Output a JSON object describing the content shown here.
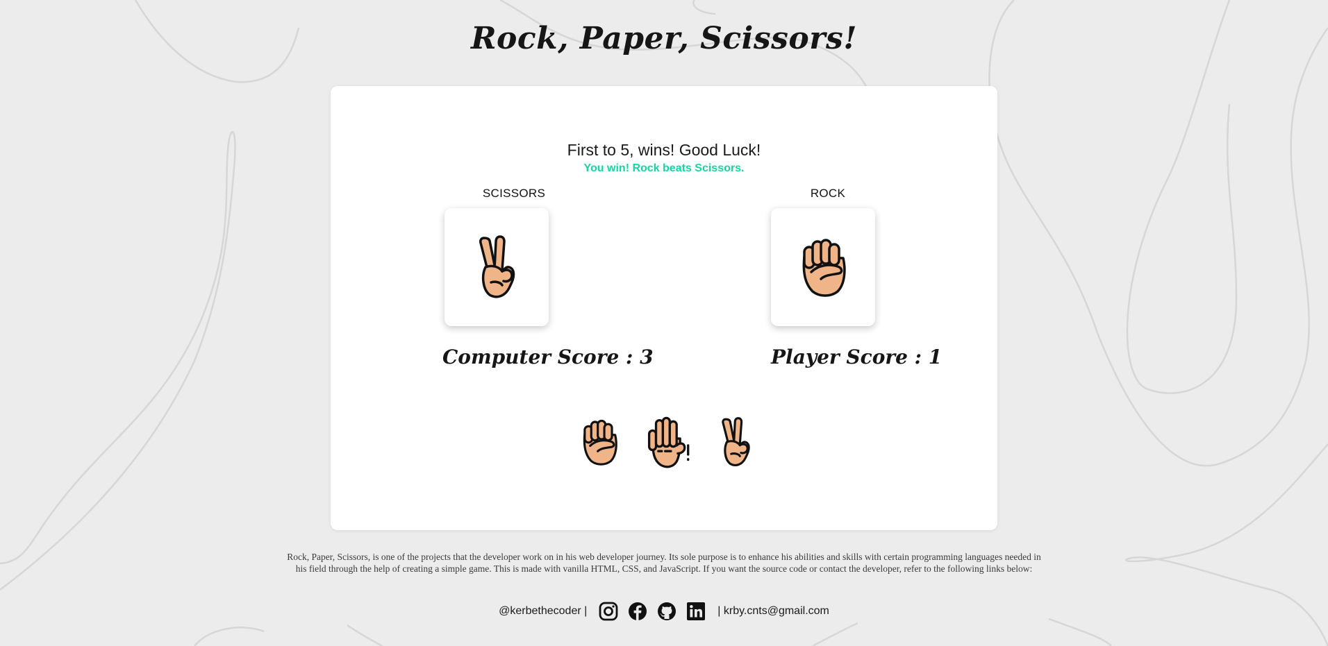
{
  "page": {
    "title": "Rock, Paper, Scissors!"
  },
  "game": {
    "instructions": "First to 5, wins! Good Luck!",
    "result_message": "You win! Rock beats Scissors.",
    "result_color": "#15d6a0",
    "computer": {
      "choice_label": "SCISSORS",
      "choice_icon": "scissors-hand-icon",
      "score_text": "Computer Score : 3",
      "score": 3
    },
    "player": {
      "choice_label": "ROCK",
      "choice_icon": "rock-fist-icon",
      "score_text": "Player Score : 1",
      "score": 1
    },
    "options": [
      {
        "name": "rock",
        "icon": "rock-fist-icon"
      },
      {
        "name": "paper",
        "icon": "paper-hand-icon"
      },
      {
        "name": "scissors",
        "icon": "scissors-hand-icon"
      }
    ],
    "skin_color": "#efb488"
  },
  "about": {
    "text": "Rock, Paper, Scissors, is one of the projects that the developer work on in his web developer journey. Its sole purpose is to enhance his abilities and skills with certain programming languages needed in his field through the help of creating a simple game. This is made with vanilla HTML, CSS, and JavaScript. If you want the source code or contact the developer, refer to the following links below:"
  },
  "footer": {
    "handle": "@kerbethecoder |",
    "email": "| krby.cnts@gmail.com",
    "social": [
      {
        "name": "instagram",
        "icon": "instagram-icon"
      },
      {
        "name": "facebook",
        "icon": "facebook-icon"
      },
      {
        "name": "github",
        "icon": "github-icon"
      },
      {
        "name": "linkedin",
        "icon": "linkedin-icon"
      }
    ]
  }
}
